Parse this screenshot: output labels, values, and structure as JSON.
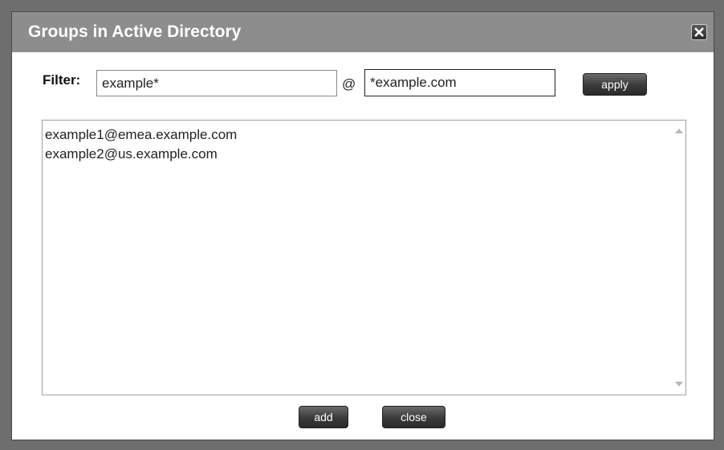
{
  "dialog": {
    "title": "Groups in Active Directory",
    "close_icon": "close-icon"
  },
  "filter": {
    "label": "Filter:",
    "name_value": "example*",
    "at_sign": "@",
    "domain_value": "*example.com",
    "apply_label": "apply"
  },
  "results": {
    "items": [
      "example1@emea.example.com",
      "example2@us.example.com"
    ]
  },
  "footer": {
    "add_label": "add",
    "close_label": "close"
  },
  "colors": {
    "titlebar": "#8d8d8d",
    "button_dark": "#3a3a3a"
  }
}
